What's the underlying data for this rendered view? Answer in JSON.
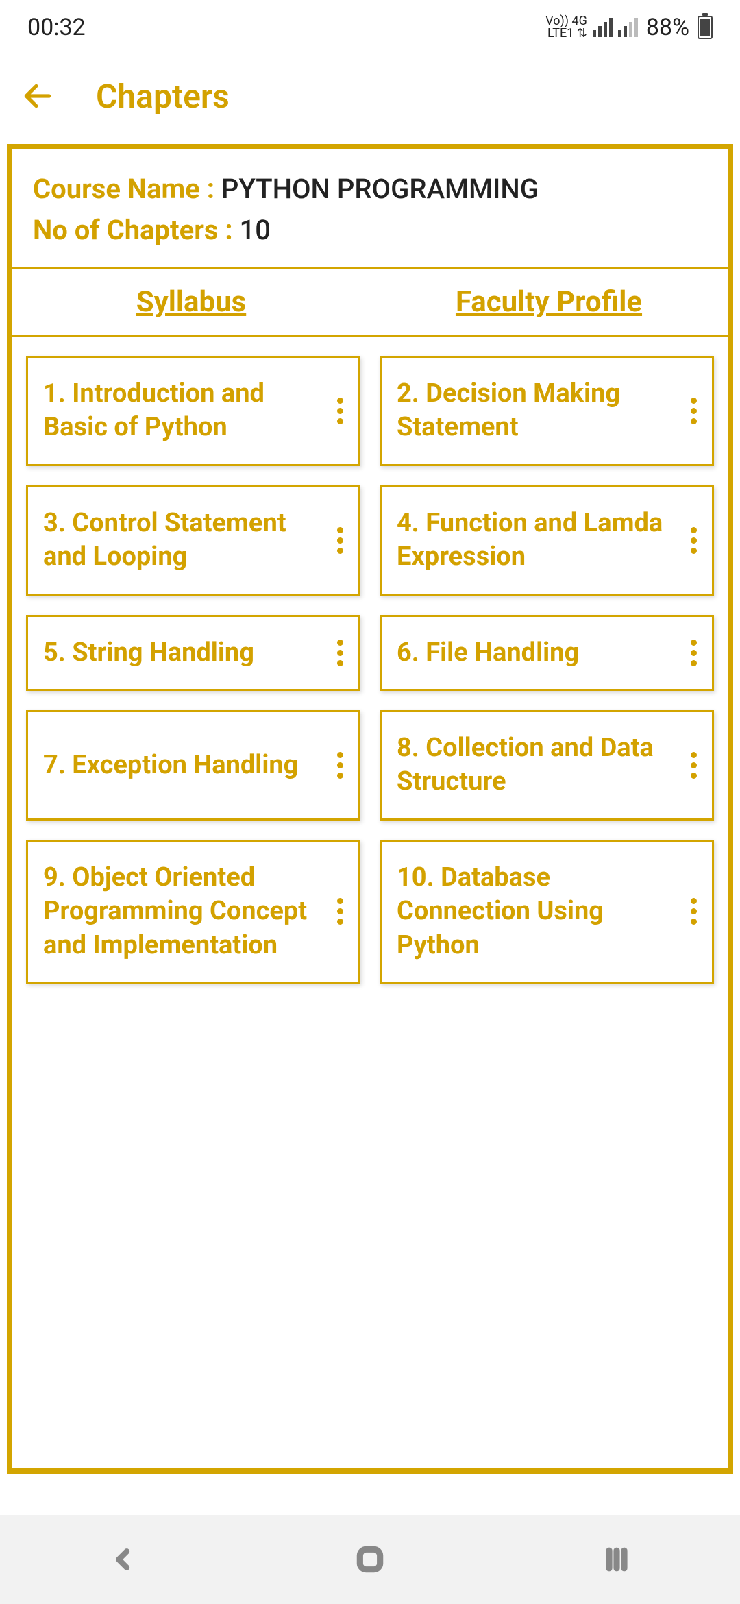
{
  "status": {
    "time": "00:32",
    "lte_top": "Vo)) 4G",
    "lte_bottom": "LTE1 ⇅",
    "battery": "88%"
  },
  "header": {
    "title": "Chapters"
  },
  "course": {
    "name_label": "Course Name : ",
    "name_value": "PYTHON PROGRAMMING",
    "chapters_label": "No of Chapters : ",
    "chapters_value": "10"
  },
  "tabs": {
    "syllabus": "Syllabus",
    "faculty": "Faculty Profile"
  },
  "chapters": [
    "1. Introduction and Basic of Python",
    "2. Decision Making Statement",
    "3. Control Statement and Looping",
    "4. Function and Lamda Expression",
    "5. String Handling",
    "6. File Handling",
    "7. Exception Handling",
    "8. Collection and Data Structure",
    "9. Object Oriented Programming Concept and Implementation",
    "10. Database Connection Using Python"
  ],
  "colors": {
    "accent": "#d3a100",
    "border": "#d3a500"
  }
}
